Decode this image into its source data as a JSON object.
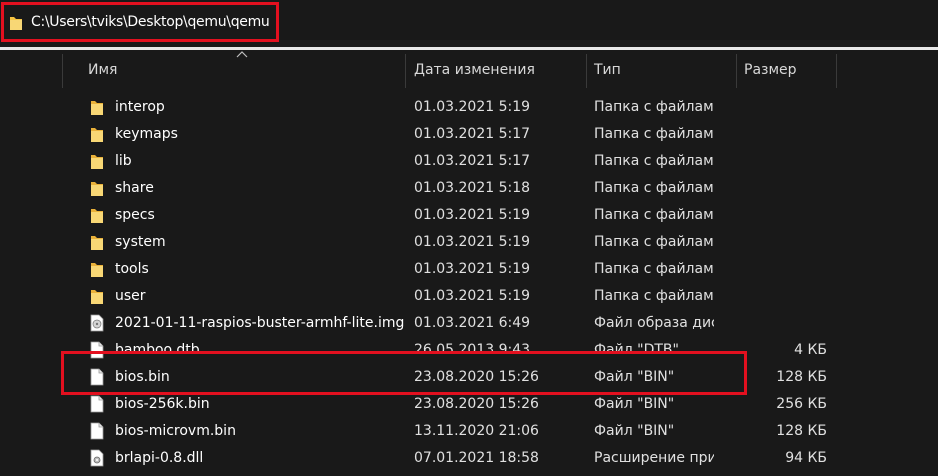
{
  "address_bar": {
    "path": "C:\\Users\\tviks\\Desktop\\qemu\\qemu"
  },
  "columns": {
    "name": "Имя",
    "date": "Дата изменения",
    "type": "Тип",
    "size": "Размер"
  },
  "colors": {
    "highlight": "#e3101f",
    "folder": "#f6c342",
    "background": "#191919"
  },
  "rows": [
    {
      "icon": "folder-icon",
      "name": "interop",
      "date": "01.03.2021 5:19",
      "type": "Папка с файлами",
      "size": ""
    },
    {
      "icon": "folder-icon",
      "name": "keymaps",
      "date": "01.03.2021 5:17",
      "type": "Папка с файлами",
      "size": ""
    },
    {
      "icon": "folder-icon",
      "name": "lib",
      "date": "01.03.2021 5:17",
      "type": "Папка с файлами",
      "size": ""
    },
    {
      "icon": "folder-icon",
      "name": "share",
      "date": "01.03.2021 5:18",
      "type": "Папка с файлами",
      "size": ""
    },
    {
      "icon": "folder-icon",
      "name": "specs",
      "date": "01.03.2021 5:19",
      "type": "Папка с файлами",
      "size": ""
    },
    {
      "icon": "folder-icon",
      "name": "system",
      "date": "01.03.2021 5:19",
      "type": "Папка с файлами",
      "size": ""
    },
    {
      "icon": "folder-icon",
      "name": "tools",
      "date": "01.03.2021 5:19",
      "type": "Папка с файлами",
      "size": ""
    },
    {
      "icon": "folder-icon",
      "name": "user",
      "date": "01.03.2021 5:19",
      "type": "Папка с файлами",
      "size": ""
    },
    {
      "icon": "disc-image-icon",
      "name": "2021-01-11-raspios-buster-armhf-lite.img",
      "date": "01.03.2021 6:49",
      "type": "Файл образа диска",
      "size": ""
    },
    {
      "icon": "file-icon",
      "name": "bamboo.dtb",
      "date": "26.05.2013 9:43",
      "type": "Файл \"DTB\"",
      "size": "4 КБ"
    },
    {
      "icon": "file-icon",
      "name": "bios.bin",
      "date": "23.08.2020 15:26",
      "type": "Файл \"BIN\"",
      "size": "128 КБ"
    },
    {
      "icon": "file-icon",
      "name": "bios-256k.bin",
      "date": "23.08.2020 15:26",
      "type": "Файл \"BIN\"",
      "size": "256 КБ"
    },
    {
      "icon": "file-icon",
      "name": "bios-microvm.bin",
      "date": "13.11.2020 21:06",
      "type": "Файл \"BIN\"",
      "size": "128 КБ"
    },
    {
      "icon": "dll-file-icon",
      "name": "brlapi-0.8.dll",
      "date": "07.01.2021 18:58",
      "type": "Расширение при",
      "size": "94 КБ"
    }
  ]
}
